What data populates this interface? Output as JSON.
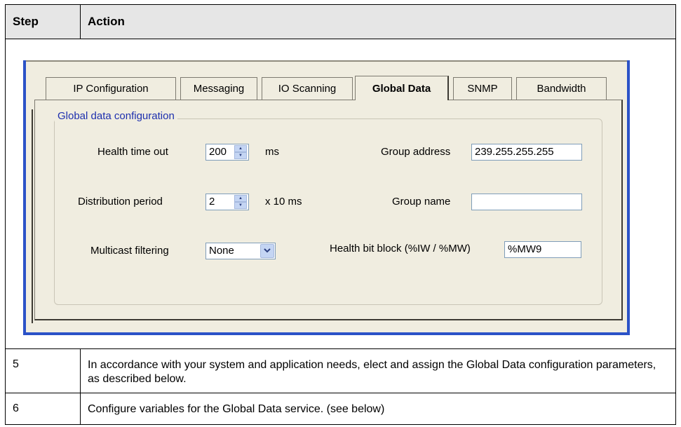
{
  "table": {
    "header": {
      "step": "Step",
      "action": "Action"
    },
    "rows": [
      {
        "step": "5",
        "action": "In accordance with your system and application needs, elect and assign the Global Data configuration parameters, as described below."
      },
      {
        "step": "6",
        "action": "Configure variables for the Global Data service. (see below)"
      }
    ]
  },
  "window": {
    "tabs": [
      "IP Configuration",
      "Messaging",
      "IO Scanning",
      "Global Data",
      "SNMP",
      "Bandwidth"
    ],
    "active_tab": "Global Data",
    "group_title": "Global data configuration",
    "fields": {
      "health_time_out": {
        "label": "Health time out",
        "value": "200",
        "unit": "ms"
      },
      "distribution_period": {
        "label": "Distribution period",
        "value": "2",
        "unit": "x 10 ms"
      },
      "multicast_filtering": {
        "label": "Multicast filtering",
        "value": "None"
      },
      "group_address": {
        "label": "Group address",
        "value": "239.255.255.255"
      },
      "group_name": {
        "label": "Group name",
        "value": ""
      },
      "health_bit_block": {
        "label": "Health bit block (%IW / %MW)",
        "value": "%MW9"
      }
    }
  },
  "colors": {
    "window_border": "#2b52c7",
    "group_title": "#1d2fae",
    "header_bg": "#e6e6e6"
  }
}
